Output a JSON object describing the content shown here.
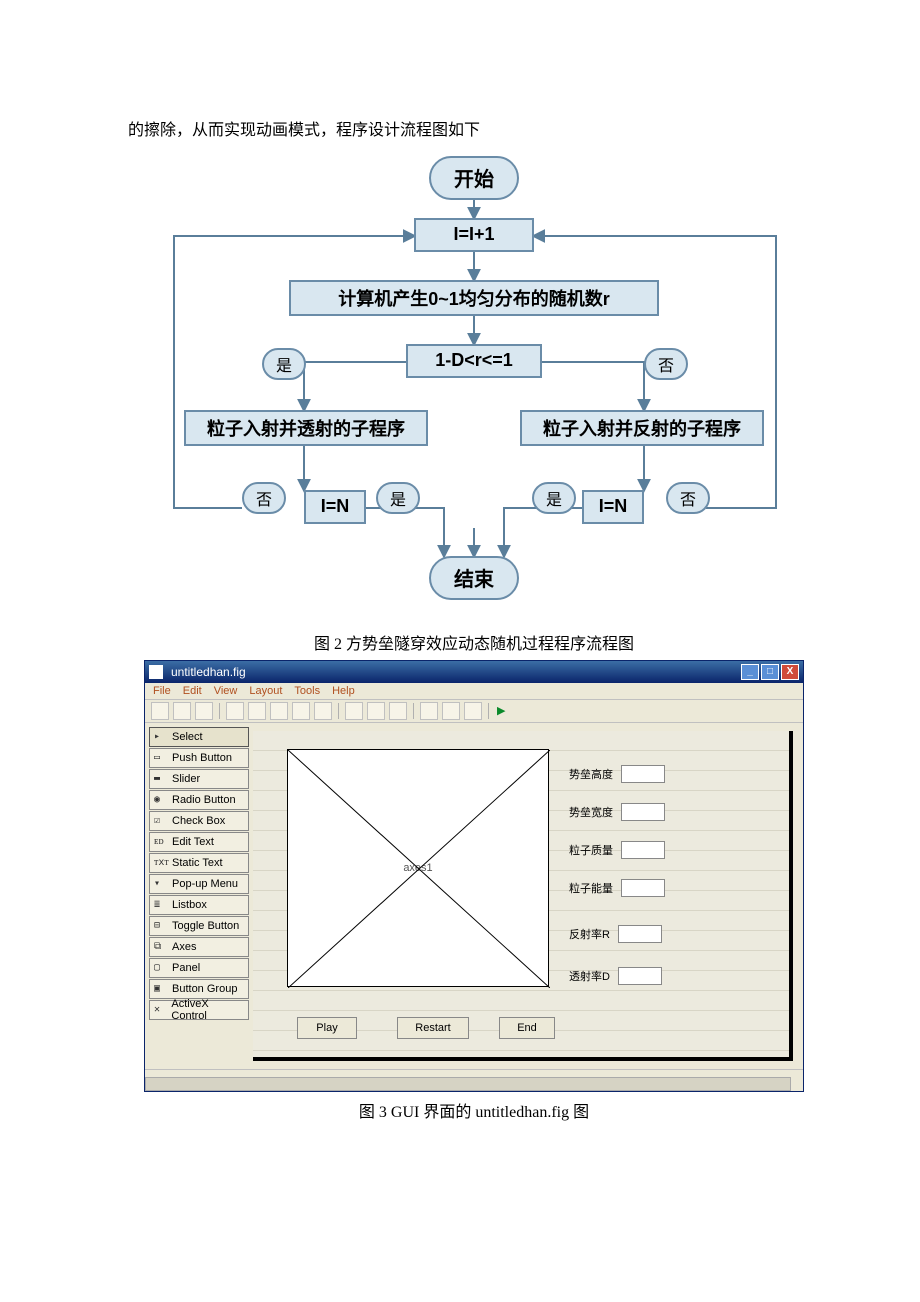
{
  "intro_text": "的擦除，从而实现动画模式，程序设计流程图如下",
  "flow": {
    "start": "开始",
    "step1": "I=I+1",
    "step2": "计算机产生0~1均匀分布的随机数r",
    "cond": "1-D<r<=1",
    "left_proc": "粒子入射并透射的子程序",
    "right_proc": "粒子入射并反射的子程序",
    "left_cond": "I=N",
    "right_cond": "I=N",
    "end": "结束",
    "yes": "是",
    "no": "否"
  },
  "caption1": "图 2  方势垒隧穿效应动态随机过程程序流程图",
  "guide": {
    "title": "untitledhan.fig",
    "menu": [
      "File",
      "Edit",
      "View",
      "Layout",
      "Tools",
      "Help"
    ],
    "palette": [
      "Select",
      "Push Button",
      "Slider",
      "Radio Button",
      "Check Box",
      "Edit Text",
      "Static Text",
      "Pop-up Menu",
      "Listbox",
      "Toggle Button",
      "Axes",
      "Panel",
      "Button Group",
      "ActiveX Control"
    ],
    "axes_label": "axes1",
    "buttons": {
      "play": "Play",
      "restart": "Restart",
      "end": "End"
    },
    "props": [
      "势垒高度",
      "势垒宽度",
      "粒子质量",
      "粒子能量",
      "反射率R",
      "透射率D"
    ]
  },
  "caption2": "图 3  GUI 界面的 untitledhan.fig 图"
}
